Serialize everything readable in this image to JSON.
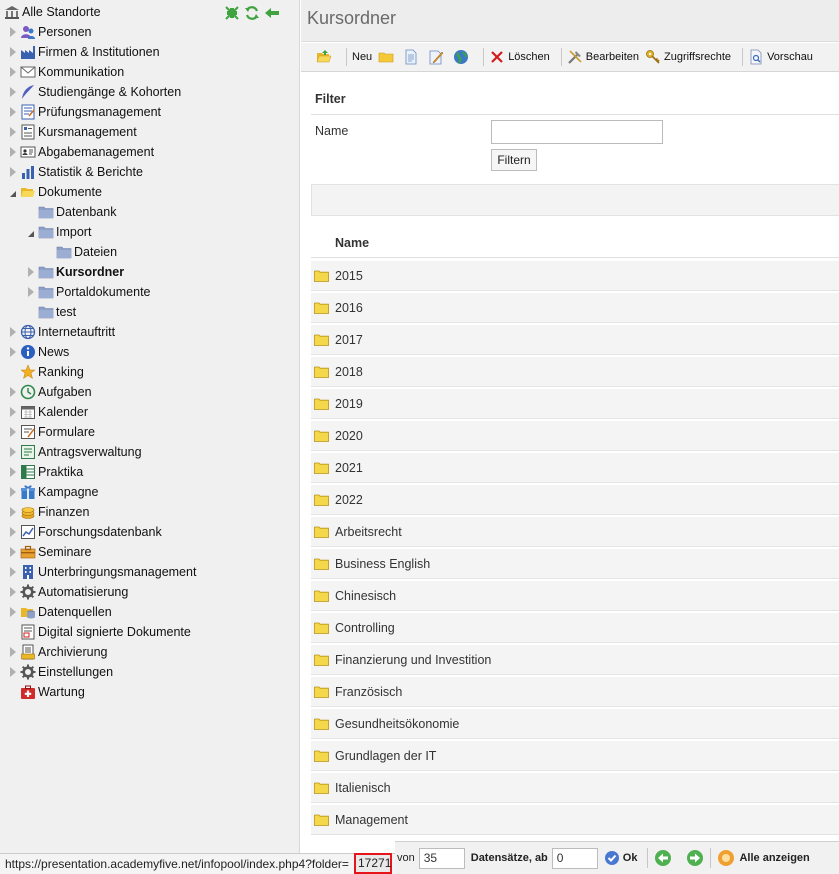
{
  "sidebar": {
    "root_label": "Alle Standorte",
    "items": [
      {
        "label": "Personen",
        "indent": 0,
        "arrow": "closed",
        "icon": "people-icon"
      },
      {
        "label": "Firmen & Institutionen",
        "indent": 0,
        "arrow": "closed",
        "icon": "factory-icon"
      },
      {
        "label": "Kommunikation",
        "indent": 0,
        "arrow": "closed",
        "icon": "envelope-icon"
      },
      {
        "label": "Studiengänge & Kohorten",
        "indent": 0,
        "arrow": "closed",
        "icon": "feather-icon"
      },
      {
        "label": "Prüfungsmanagement",
        "indent": 0,
        "arrow": "closed",
        "icon": "exam-icon"
      },
      {
        "label": "Kursmanagement",
        "indent": 0,
        "arrow": "closed",
        "icon": "course-icon"
      },
      {
        "label": "Abgabemanagement",
        "indent": 0,
        "arrow": "closed",
        "icon": "id-card-icon"
      },
      {
        "label": "Statistik & Berichte",
        "indent": 0,
        "arrow": "closed",
        "icon": "bar-chart-icon"
      },
      {
        "label": "Dokumente",
        "indent": 0,
        "arrow": "open",
        "icon": "open-folder-icon"
      },
      {
        "label": "Datenbank",
        "indent": 1,
        "arrow": "none",
        "icon": "folder-icon"
      },
      {
        "label": "Import",
        "indent": 1,
        "arrow": "open",
        "icon": "folder-icon"
      },
      {
        "label": "Dateien",
        "indent": 2,
        "arrow": "none",
        "icon": "folder-icon"
      },
      {
        "label": "Kursordner",
        "indent": 1,
        "arrow": "closed",
        "icon": "folder-icon",
        "bold": true
      },
      {
        "label": "Portaldokumente",
        "indent": 1,
        "arrow": "closed",
        "icon": "folder-icon"
      },
      {
        "label": "test",
        "indent": 1,
        "arrow": "none",
        "icon": "folder-icon"
      },
      {
        "label": "Internetauftritt",
        "indent": 0,
        "arrow": "closed",
        "icon": "globe-icon"
      },
      {
        "label": "News",
        "indent": 0,
        "arrow": "closed",
        "icon": "info-icon"
      },
      {
        "label": "Ranking",
        "indent": 0,
        "arrow": "none",
        "icon": "star-icon"
      },
      {
        "label": "Aufgaben",
        "indent": 0,
        "arrow": "closed",
        "icon": "clock-icon"
      },
      {
        "label": "Kalender",
        "indent": 0,
        "arrow": "closed",
        "icon": "calendar-icon"
      },
      {
        "label": "Formulare",
        "indent": 0,
        "arrow": "closed",
        "icon": "form-icon"
      },
      {
        "label": "Antragsverwaltung",
        "indent": 0,
        "arrow": "closed",
        "icon": "application-icon"
      },
      {
        "label": "Praktika",
        "indent": 0,
        "arrow": "closed",
        "icon": "table-icon"
      },
      {
        "label": "Kampagne",
        "indent": 0,
        "arrow": "closed",
        "icon": "gift-icon"
      },
      {
        "label": "Finanzen",
        "indent": 0,
        "arrow": "closed",
        "icon": "coins-icon"
      },
      {
        "label": "Forschungsdatenbank",
        "indent": 0,
        "arrow": "closed",
        "icon": "line-chart-icon"
      },
      {
        "label": "Seminare",
        "indent": 0,
        "arrow": "closed",
        "icon": "briefcase-icon"
      },
      {
        "label": "Unterbringungsmanagement",
        "indent": 0,
        "arrow": "closed",
        "icon": "building-icon"
      },
      {
        "label": "Automatisierung",
        "indent": 0,
        "arrow": "closed",
        "icon": "gear-icon"
      },
      {
        "label": "Datenquellen",
        "indent": 0,
        "arrow": "closed",
        "icon": "database-icon"
      },
      {
        "label": "Digital signierte Dokumente",
        "indent": 0,
        "arrow": "none",
        "icon": "signed-document-icon"
      },
      {
        "label": "Archivierung",
        "indent": 0,
        "arrow": "closed",
        "icon": "archive-icon"
      },
      {
        "label": "Einstellungen",
        "indent": 0,
        "arrow": "closed",
        "icon": "gear-icon"
      },
      {
        "label": "Wartung",
        "indent": 0,
        "arrow": "none",
        "icon": "first-aid-icon"
      }
    ]
  },
  "page": {
    "title": "Kursordner"
  },
  "toolbar": {
    "new_label": "Neu",
    "delete_label": "Löschen",
    "edit_label": "Bearbeiten",
    "access_label": "Zugriffsrechte",
    "preview_label": "Vorschau"
  },
  "filter": {
    "title": "Filter",
    "name_label": "Name",
    "name_value": "",
    "button_label": "Filtern"
  },
  "list": {
    "column_name": "Name",
    "folders": [
      "2015",
      "2016",
      "2017",
      "2018",
      "2019",
      "2020",
      "2021",
      "2022",
      "Arbeitsrecht",
      "Business English",
      "Chinesisch",
      "Controlling",
      "Finanzierung und Investition",
      "Französisch",
      "Gesundheitsökonomie",
      "Grundlagen der IT",
      "Italienisch",
      "Management"
    ]
  },
  "status": {
    "url": "https://presentation.academyfive.net/infopool/index.php4?folder=",
    "folder_id": "17271"
  },
  "pager": {
    "of_label": "von",
    "of_value": "35",
    "records_label": "Datensätze, ab",
    "records_value": "0",
    "ok_label": "Ok",
    "show_all_label": "Alle anzeigen"
  },
  "colors": {
    "folder_yellow": "#f5d84a",
    "folder_blue": "#8ea0c8",
    "highlight_red": "#e8141b",
    "sidebar_bg": "#f0f0f0"
  }
}
